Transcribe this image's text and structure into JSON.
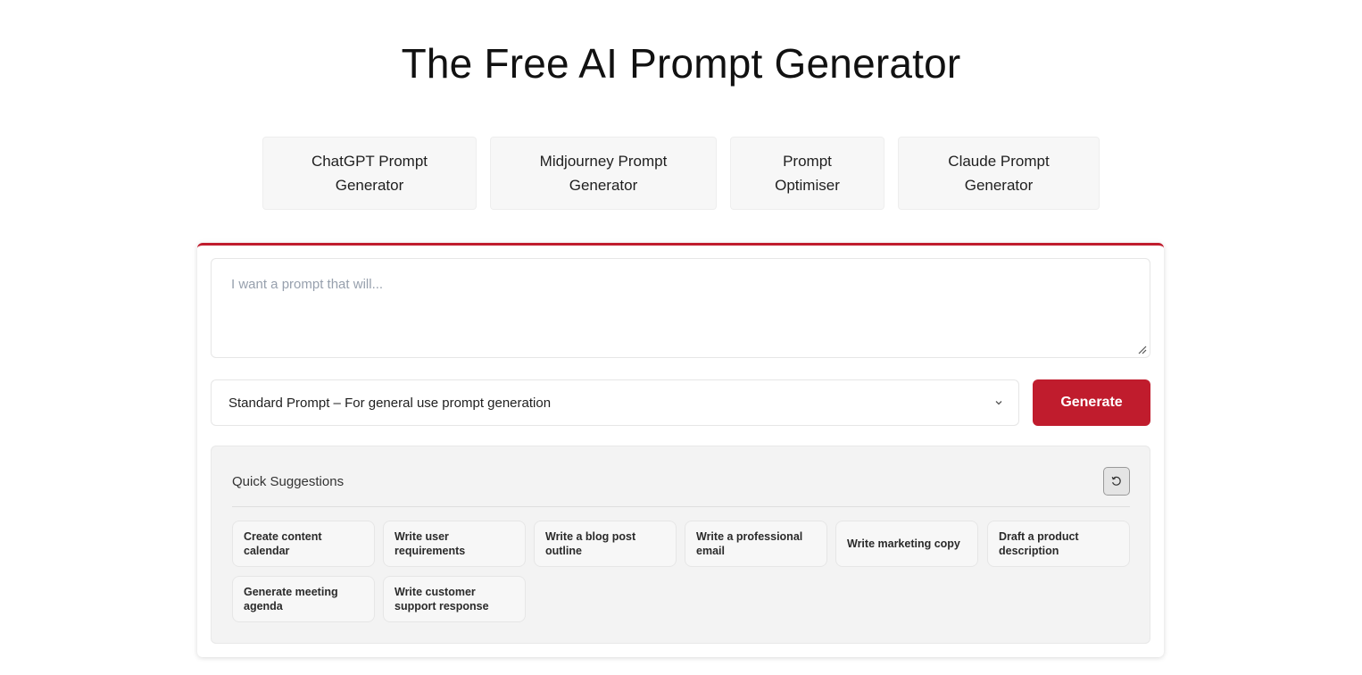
{
  "page": {
    "title": "The Free AI Prompt Generator"
  },
  "tool_tabs": [
    {
      "line1": "ChatGPT Prompt",
      "line2": "Generator"
    },
    {
      "line1": "Midjourney Prompt",
      "line2": "Generator"
    },
    {
      "line1": "Prompt",
      "line2": "Optimiser"
    },
    {
      "line1": "Claude Prompt",
      "line2": "Generator"
    }
  ],
  "form": {
    "prompt_placeholder": "I want a prompt that will...",
    "prompt_value": "",
    "mode_selected": "Standard Prompt – For general use prompt generation",
    "generate_label": "Generate"
  },
  "suggestions": {
    "title": "Quick Suggestions",
    "items": [
      "Create content calendar",
      "Write user requirements",
      "Write a blog post outline",
      "Write a professional email",
      "Write marketing copy",
      "Draft a product description",
      "Generate meeting agenda",
      "Write customer support response"
    ]
  },
  "icons": {
    "mode_dropdown": "chevron-down-icon",
    "refresh": "refresh-icon",
    "resize": "resize-grip-icon"
  },
  "colors": {
    "accent": "#c01c2d",
    "tab_bg": "#f7f7f7",
    "panel_bg": "#f3f3f3",
    "placeholder": "#97a0ad"
  }
}
